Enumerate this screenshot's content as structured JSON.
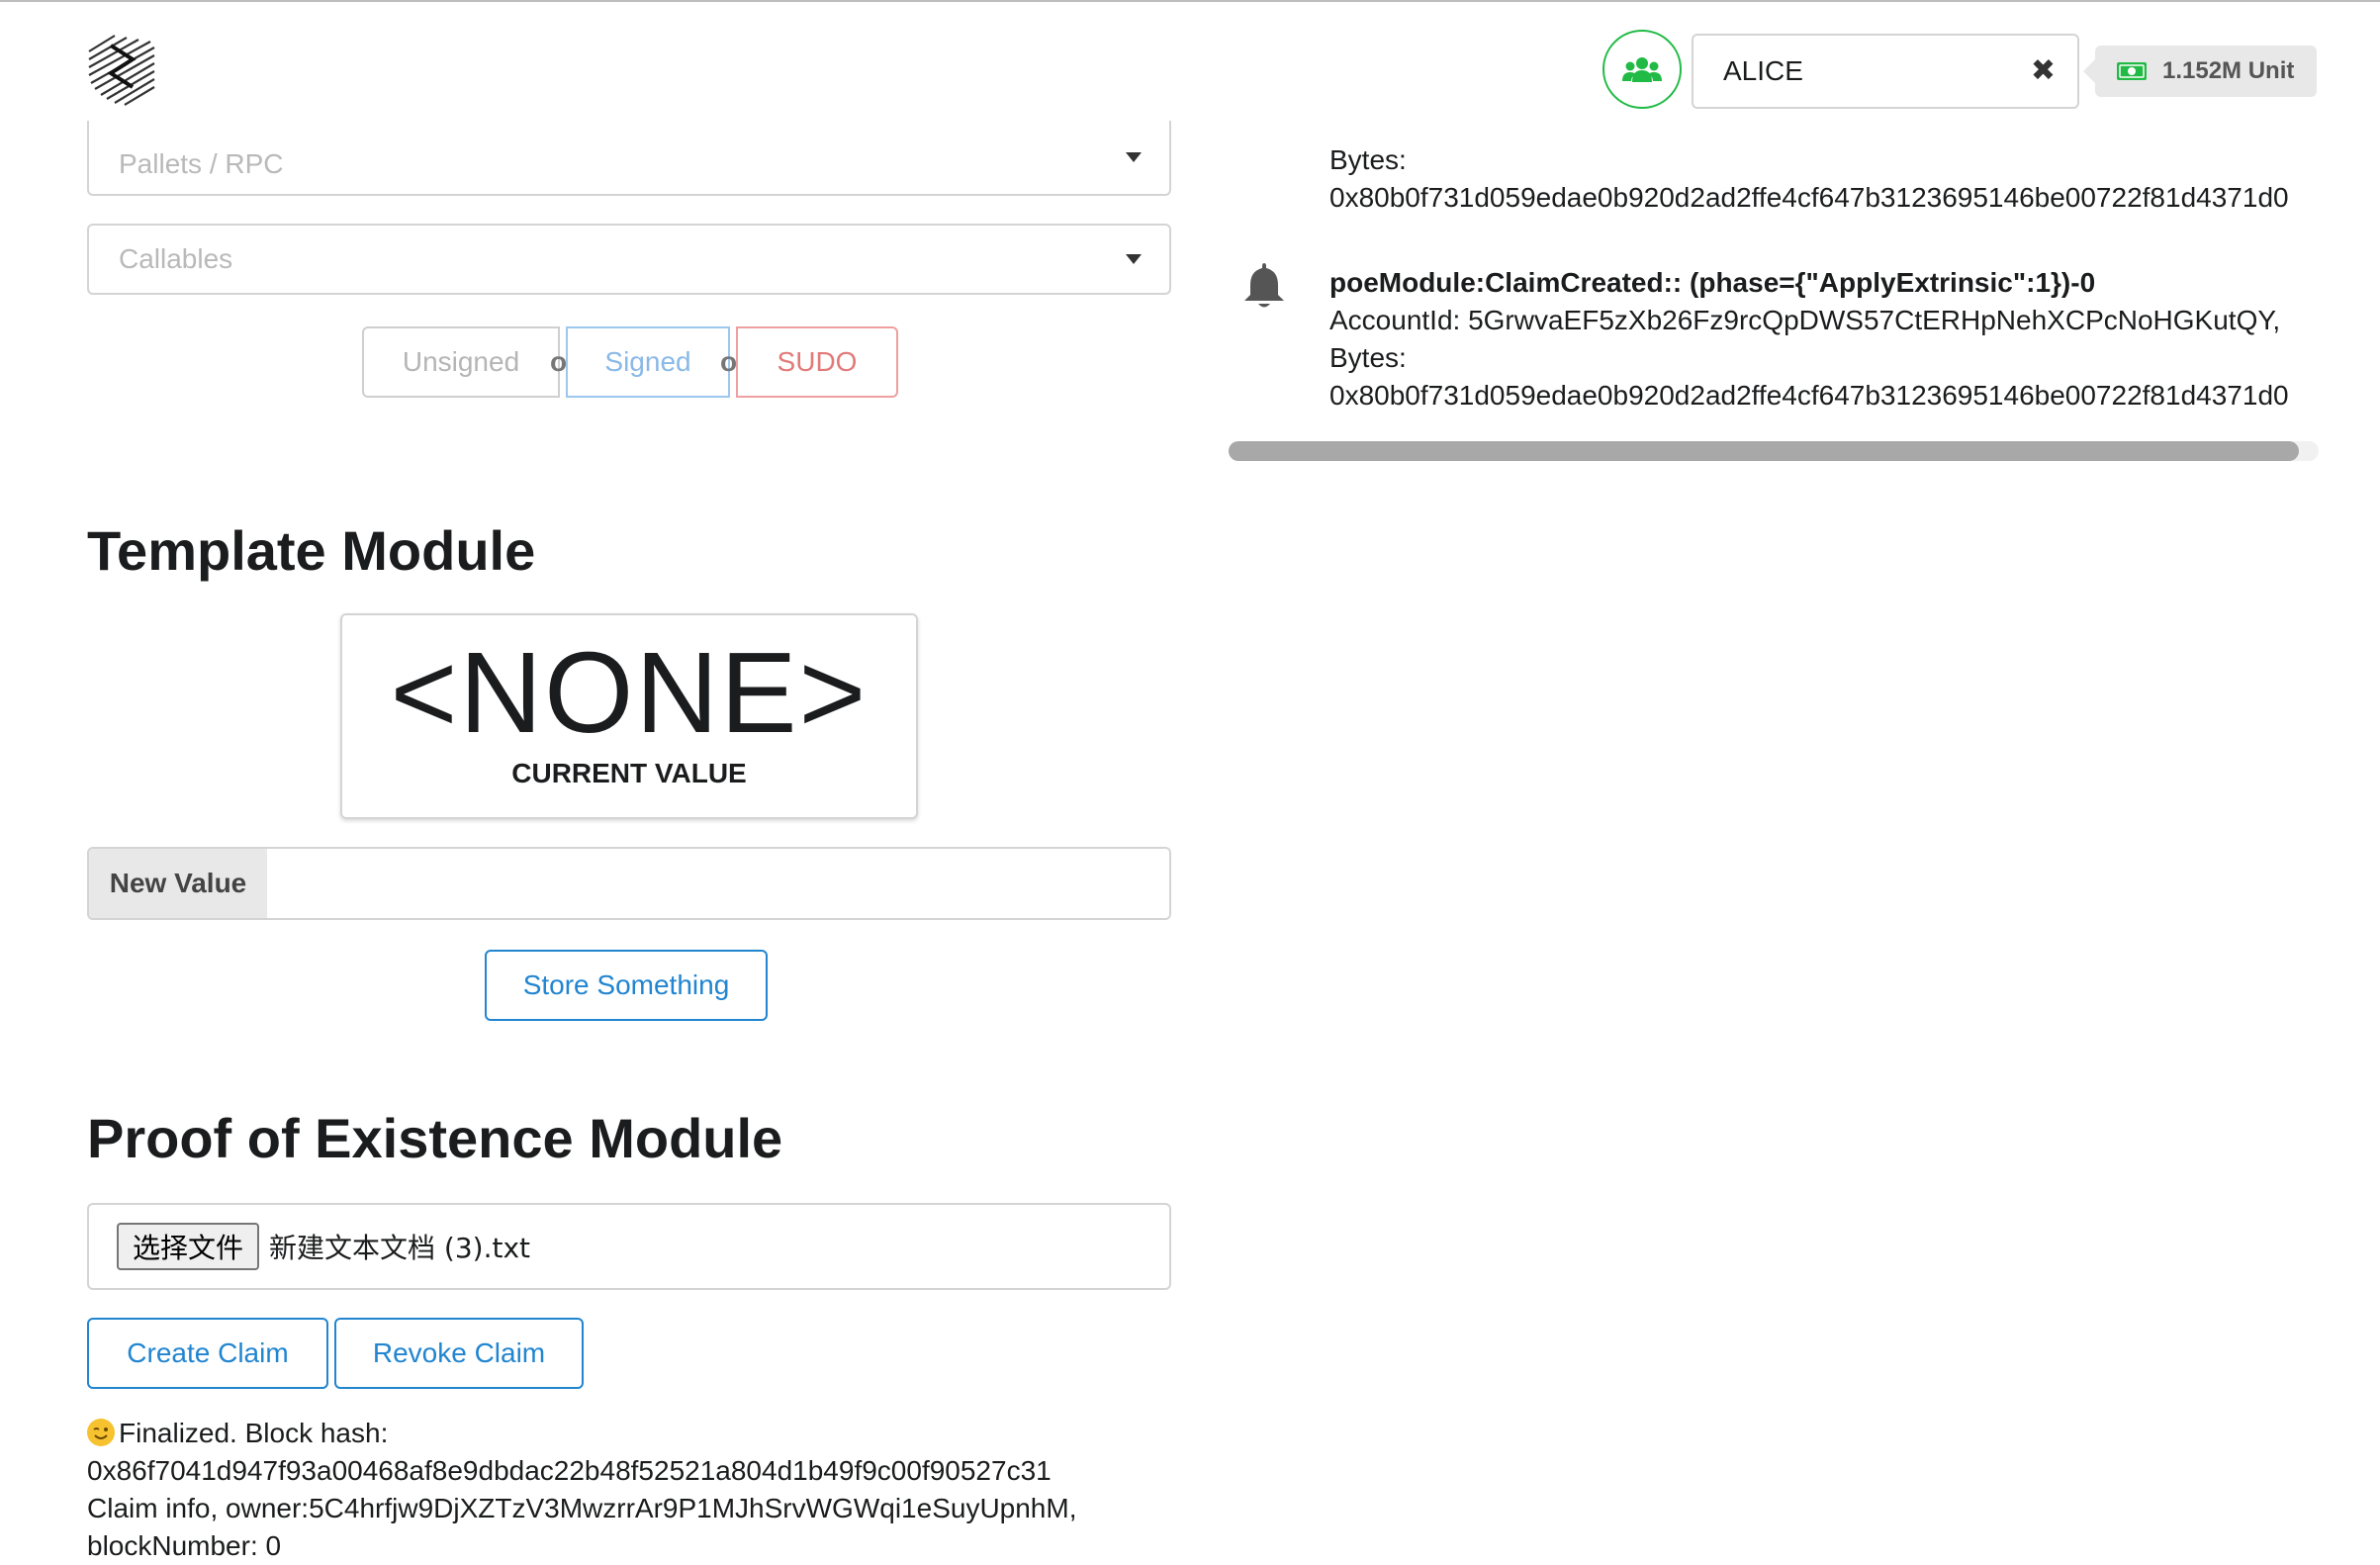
{
  "header": {
    "account": {
      "name": "ALICE",
      "clear_icon": "close-icon",
      "group_icon": "users-icon"
    },
    "balance": {
      "text": "1.152M Unit",
      "icon": "money-bill-icon"
    },
    "colors": {
      "account_green": "#21ba45",
      "primary_blue": "#2185d0",
      "signed_blue": "#7fb2e5",
      "sudo_red": "#e27a7a"
    }
  },
  "extrinsics": {
    "pallet_placeholder": "Pallets / RPC",
    "callable_placeholder": "Callables",
    "buttons": {
      "unsigned": "Unsigned",
      "or1": "or",
      "signed": "Signed",
      "or2": "or",
      "sudo": "SUDO"
    }
  },
  "template_module": {
    "title": "Template Module",
    "current_value": "<NONE>",
    "current_value_label": "CURRENT VALUE",
    "input_label": "New Value",
    "input_value": "",
    "button": "Store Something"
  },
  "poe_module": {
    "title": "Proof of Existence Module",
    "choose_file_label": "选择文件",
    "file_name": "新建文本文档 (3).txt",
    "create_button": "Create Claim",
    "revoke_button": "Revoke Claim",
    "status": {
      "finalized": "Finalized. Block hash:",
      "block_hash": "0x86f7041d947f93a00468af8e9dbdac22b48f52521a804d1b49f9c00f90527c31",
      "claim_info": "Claim info, owner:5C4hrfjw9DjXZTzV3MwzrrAr9P1MJhSrvWGWqi1eSuyUpnhM,",
      "block_number": "blockNumber: 0"
    }
  },
  "events": {
    "partial": {
      "bytes_label": "Bytes:",
      "bytes_value": "0x80b0f731d059edae0b920d2ad2ffe4cf647b3123695146be00722f81d4371d0"
    },
    "items": [
      {
        "icon": "bell-icon",
        "title": "poeModule:ClaimCreated:: (phase={\"ApplyExtrinsic\":1})-0",
        "account_line": "AccountId: 5GrwvaEF5zXb26Fz9rcQpDWS57CtERHpNehXCPcNoHGKutQY,",
        "bytes_label": "Bytes:",
        "bytes_value": "0x80b0f731d059edae0b920d2ad2ffe4cf647b3123695146be00722f81d4371d0"
      }
    ]
  }
}
